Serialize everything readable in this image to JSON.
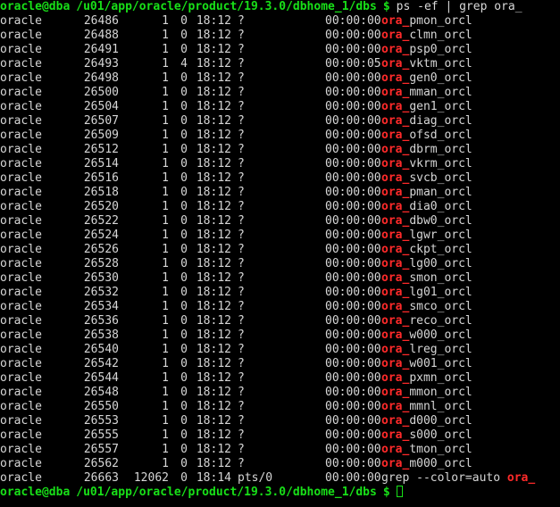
{
  "terminal": {
    "background_color": "#000000",
    "prompt_color": "#18e018",
    "output_color": "#d6d6d6",
    "match_color": "#ff2a2a",
    "user_host": "oracle@dba",
    "path": "/u01/app/oracle/product/19.3.0/dbhome_1/dbs",
    "dollar": "$",
    "command": "ps -ef | grep ora_",
    "cursor_glyph": "block-cursor"
  },
  "rows": [
    {
      "user": "oracle",
      "pid": "26486",
      "ppid": "1",
      "c": "0",
      "stime": "18:12",
      "tty": "?",
      "time": "00:00:00",
      "match": "ora_",
      "cmd": "pmon_orcl"
    },
    {
      "user": "oracle",
      "pid": "26488",
      "ppid": "1",
      "c": "0",
      "stime": "18:12",
      "tty": "?",
      "time": "00:00:00",
      "match": "ora_",
      "cmd": "clmn_orcl"
    },
    {
      "user": "oracle",
      "pid": "26491",
      "ppid": "1",
      "c": "0",
      "stime": "18:12",
      "tty": "?",
      "time": "00:00:00",
      "match": "ora_",
      "cmd": "psp0_orcl"
    },
    {
      "user": "oracle",
      "pid": "26493",
      "ppid": "1",
      "c": "4",
      "stime": "18:12",
      "tty": "?",
      "time": "00:00:05",
      "match": "ora_",
      "cmd": "vktm_orcl"
    },
    {
      "user": "oracle",
      "pid": "26498",
      "ppid": "1",
      "c": "0",
      "stime": "18:12",
      "tty": "?",
      "time": "00:00:00",
      "match": "ora_",
      "cmd": "gen0_orcl"
    },
    {
      "user": "oracle",
      "pid": "26500",
      "ppid": "1",
      "c": "0",
      "stime": "18:12",
      "tty": "?",
      "time": "00:00:00",
      "match": "ora_",
      "cmd": "mman_orcl"
    },
    {
      "user": "oracle",
      "pid": "26504",
      "ppid": "1",
      "c": "0",
      "stime": "18:12",
      "tty": "?",
      "time": "00:00:00",
      "match": "ora_",
      "cmd": "gen1_orcl"
    },
    {
      "user": "oracle",
      "pid": "26507",
      "ppid": "1",
      "c": "0",
      "stime": "18:12",
      "tty": "?",
      "time": "00:00:00",
      "match": "ora_",
      "cmd": "diag_orcl"
    },
    {
      "user": "oracle",
      "pid": "26509",
      "ppid": "1",
      "c": "0",
      "stime": "18:12",
      "tty": "?",
      "time": "00:00:00",
      "match": "ora_",
      "cmd": "ofsd_orcl"
    },
    {
      "user": "oracle",
      "pid": "26512",
      "ppid": "1",
      "c": "0",
      "stime": "18:12",
      "tty": "?",
      "time": "00:00:00",
      "match": "ora_",
      "cmd": "dbrm_orcl"
    },
    {
      "user": "oracle",
      "pid": "26514",
      "ppid": "1",
      "c": "0",
      "stime": "18:12",
      "tty": "?",
      "time": "00:00:00",
      "match": "ora_",
      "cmd": "vkrm_orcl"
    },
    {
      "user": "oracle",
      "pid": "26516",
      "ppid": "1",
      "c": "0",
      "stime": "18:12",
      "tty": "?",
      "time": "00:00:00",
      "match": "ora_",
      "cmd": "svcb_orcl"
    },
    {
      "user": "oracle",
      "pid": "26518",
      "ppid": "1",
      "c": "0",
      "stime": "18:12",
      "tty": "?",
      "time": "00:00:00",
      "match": "ora_",
      "cmd": "pman_orcl"
    },
    {
      "user": "oracle",
      "pid": "26520",
      "ppid": "1",
      "c": "0",
      "stime": "18:12",
      "tty": "?",
      "time": "00:00:00",
      "match": "ora_",
      "cmd": "dia0_orcl"
    },
    {
      "user": "oracle",
      "pid": "26522",
      "ppid": "1",
      "c": "0",
      "stime": "18:12",
      "tty": "?",
      "time": "00:00:00",
      "match": "ora_",
      "cmd": "dbw0_orcl"
    },
    {
      "user": "oracle",
      "pid": "26524",
      "ppid": "1",
      "c": "0",
      "stime": "18:12",
      "tty": "?",
      "time": "00:00:00",
      "match": "ora_",
      "cmd": "lgwr_orcl"
    },
    {
      "user": "oracle",
      "pid": "26526",
      "ppid": "1",
      "c": "0",
      "stime": "18:12",
      "tty": "?",
      "time": "00:00:00",
      "match": "ora_",
      "cmd": "ckpt_orcl"
    },
    {
      "user": "oracle",
      "pid": "26528",
      "ppid": "1",
      "c": "0",
      "stime": "18:12",
      "tty": "?",
      "time": "00:00:00",
      "match": "ora_",
      "cmd": "lg00_orcl"
    },
    {
      "user": "oracle",
      "pid": "26530",
      "ppid": "1",
      "c": "0",
      "stime": "18:12",
      "tty": "?",
      "time": "00:00:00",
      "match": "ora_",
      "cmd": "smon_orcl"
    },
    {
      "user": "oracle",
      "pid": "26532",
      "ppid": "1",
      "c": "0",
      "stime": "18:12",
      "tty": "?",
      "time": "00:00:00",
      "match": "ora_",
      "cmd": "lg01_orcl"
    },
    {
      "user": "oracle",
      "pid": "26534",
      "ppid": "1",
      "c": "0",
      "stime": "18:12",
      "tty": "?",
      "time": "00:00:00",
      "match": "ora_",
      "cmd": "smco_orcl"
    },
    {
      "user": "oracle",
      "pid": "26536",
      "ppid": "1",
      "c": "0",
      "stime": "18:12",
      "tty": "?",
      "time": "00:00:00",
      "match": "ora_",
      "cmd": "reco_orcl"
    },
    {
      "user": "oracle",
      "pid": "26538",
      "ppid": "1",
      "c": "0",
      "stime": "18:12",
      "tty": "?",
      "time": "00:00:00",
      "match": "ora_",
      "cmd": "w000_orcl"
    },
    {
      "user": "oracle",
      "pid": "26540",
      "ppid": "1",
      "c": "0",
      "stime": "18:12",
      "tty": "?",
      "time": "00:00:00",
      "match": "ora_",
      "cmd": "lreg_orcl"
    },
    {
      "user": "oracle",
      "pid": "26542",
      "ppid": "1",
      "c": "0",
      "stime": "18:12",
      "tty": "?",
      "time": "00:00:00",
      "match": "ora_",
      "cmd": "w001_orcl"
    },
    {
      "user": "oracle",
      "pid": "26544",
      "ppid": "1",
      "c": "0",
      "stime": "18:12",
      "tty": "?",
      "time": "00:00:00",
      "match": "ora_",
      "cmd": "pxmn_orcl"
    },
    {
      "user": "oracle",
      "pid": "26548",
      "ppid": "1",
      "c": "0",
      "stime": "18:12",
      "tty": "?",
      "time": "00:00:00",
      "match": "ora_",
      "cmd": "mmon_orcl"
    },
    {
      "user": "oracle",
      "pid": "26550",
      "ppid": "1",
      "c": "0",
      "stime": "18:12",
      "tty": "?",
      "time": "00:00:00",
      "match": "ora_",
      "cmd": "mmnl_orcl"
    },
    {
      "user": "oracle",
      "pid": "26553",
      "ppid": "1",
      "c": "0",
      "stime": "18:12",
      "tty": "?",
      "time": "00:00:00",
      "match": "ora_",
      "cmd": "d000_orcl"
    },
    {
      "user": "oracle",
      "pid": "26555",
      "ppid": "1",
      "c": "0",
      "stime": "18:12",
      "tty": "?",
      "time": "00:00:00",
      "match": "ora_",
      "cmd": "s000_orcl"
    },
    {
      "user": "oracle",
      "pid": "26557",
      "ppid": "1",
      "c": "0",
      "stime": "18:12",
      "tty": "?",
      "time": "00:00:00",
      "match": "ora_",
      "cmd": "tmon_orcl"
    },
    {
      "user": "oracle",
      "pid": "26562",
      "ppid": "1",
      "c": "0",
      "stime": "18:12",
      "tty": "?",
      "time": "00:00:00",
      "match": "ora_",
      "cmd": "m000_orcl"
    },
    {
      "user": "oracle",
      "pid": "26663",
      "ppid": "12062",
      "c": "0",
      "stime": "18:14",
      "tty": "pts/0",
      "time": "00:00:00",
      "cmd_prefix": "grep --color=auto ",
      "match": "ora_",
      "cmd": ""
    }
  ]
}
